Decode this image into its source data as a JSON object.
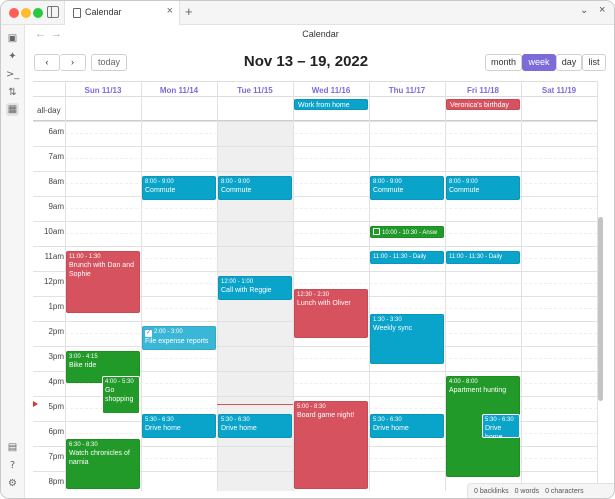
{
  "app": {
    "tab_title": "Calendar",
    "view_title": "Calendar",
    "new_tab": "+",
    "close_tab": "×"
  },
  "toolbar": {
    "prev": "‹",
    "next": "›",
    "today": "today",
    "range": "Nov 13 – 19, 2022",
    "views": [
      "month",
      "week",
      "day",
      "list"
    ],
    "active_view": "week"
  },
  "days": [
    "Sun 11/13",
    "Mon 11/14",
    "Tue 11/15",
    "Wed 11/16",
    "Thu 11/17",
    "Fri 11/18",
    "Sat 11/19"
  ],
  "allday_label": "all-day",
  "hours": [
    "6am",
    "7am",
    "8am",
    "9am",
    "10am",
    "11am",
    "12pm",
    "1pm",
    "2pm",
    "3pm",
    "4pm",
    "5pm",
    "6pm",
    "7pm",
    "8pm"
  ],
  "allday_events": [
    {
      "day": "Wed 11/16",
      "title": "Work from home",
      "color": "#0aa3c9"
    },
    {
      "day": "Fri 11/18",
      "title": "Veronica's birthday",
      "color": "#d6525e"
    }
  ],
  "events": [
    {
      "day": "Mon 11/14",
      "time": "8:00 - 9:00",
      "title": "Commute"
    },
    {
      "day": "Tue 11/15",
      "time": "8:00 - 9:00",
      "title": "Commute"
    },
    {
      "day": "Thu 11/17",
      "time": "8:00 - 9:00",
      "title": "Commute"
    },
    {
      "day": "Fri 11/18",
      "time": "8:00 - 9:00",
      "title": "Commute"
    },
    {
      "day": "Thu 11/17",
      "time": "10:00 - 10:30",
      "title": "Answ",
      "checkbox": "unchecked"
    },
    {
      "day": "Sun 11/13",
      "time": "11:00 - 1:30",
      "title": "Brunch with Dan and Sophie"
    },
    {
      "day": "Thu 11/17",
      "time": "11:00 - 11:30",
      "title": "Daily"
    },
    {
      "day": "Fri 11/18",
      "time": "11:00 - 11:30",
      "title": "Daily"
    },
    {
      "day": "Tue 11/15",
      "time": "12:00 - 1:00",
      "title": "Call with Reggie"
    },
    {
      "day": "Wed 11/16",
      "time": "12:30 - 2:30",
      "title": "Lunch with Oliver"
    },
    {
      "day": "Thu 11/17",
      "time": "1:30 - 3:30",
      "title": "Weekly sync"
    },
    {
      "day": "Mon 11/14",
      "time": "2:00 - 3:00",
      "title": "File expense reports",
      "checkbox": "checked"
    },
    {
      "day": "Sun 11/13",
      "time": "3:00 - 4:15",
      "title": "Bike ride"
    },
    {
      "day": "Sun 11/13",
      "time": "4:00 - 5:30",
      "title": "Go shopping"
    },
    {
      "day": "Fri 11/18",
      "time": "4:00 - 8:00",
      "title": "Apartment hunting"
    },
    {
      "day": "Wed 11/16",
      "time": "5:00 - 8:30",
      "title": "Board game night!"
    },
    {
      "day": "Mon 11/14",
      "time": "5:30 - 6:30",
      "title": "Drive home"
    },
    {
      "day": "Tue 11/15",
      "time": "5:30 - 6:30",
      "title": "Drive home"
    },
    {
      "day": "Thu 11/17",
      "time": "5:30 - 6:30",
      "title": "Drive home"
    },
    {
      "day": "Fri 11/18",
      "time": "5:30 - 6:30",
      "title": "Drive home"
    },
    {
      "day": "Sun 11/13",
      "time": "6:30 - 8:30",
      "title": "Watch chronicles of narnia"
    }
  ],
  "status": {
    "backlinks": "0 backlinks",
    "words": "0 words",
    "characters": "0 characters"
  },
  "colors": {
    "accent": "#7b6cd9",
    "blue": "#0aa3c9",
    "red": "#d6525e",
    "green": "#229a29"
  }
}
